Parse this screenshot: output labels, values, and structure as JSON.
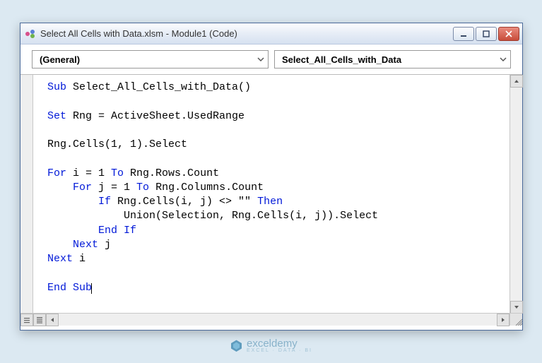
{
  "titlebar": {
    "title": "Select All Cells with Data.xlsm - Module1 (Code)"
  },
  "dropdowns": {
    "object": "(General)",
    "procedure": "Select_All_Cells_with_Data"
  },
  "code": {
    "l1_kw": "Sub",
    "l1_rest": " Select_All_Cells_with_Data()",
    "l3_kw": "Set",
    "l3_rest": " Rng = ActiveSheet.UsedRange",
    "l5": "Rng.Cells(1, 1).Select",
    "l7_kw1": "For",
    "l7_mid": " i = 1 ",
    "l7_kw2": "To",
    "l7_rest": " Rng.Rows.Count",
    "l8_indent": "    ",
    "l8_kw1": "For",
    "l8_mid": " j = 1 ",
    "l8_kw2": "To",
    "l8_rest": " Rng.Columns.Count",
    "l9_indent": "        ",
    "l9_kw": "If",
    "l9_mid": " Rng.Cells(i, j) <> \"\" ",
    "l9_kw2": "Then",
    "l10_indent": "            ",
    "l10": "Union(Selection, Rng.Cells(i, j)).Select",
    "l11_indent": "        ",
    "l11_kw": "End If",
    "l12_indent": "    ",
    "l12_kw": "Next",
    "l12_rest": " j",
    "l13_kw": "Next",
    "l13_rest": " i",
    "l15_kw": "End Sub"
  },
  "watermark": {
    "brand": "exceldemy",
    "tagline": "EXCEL · DATA · BI"
  }
}
